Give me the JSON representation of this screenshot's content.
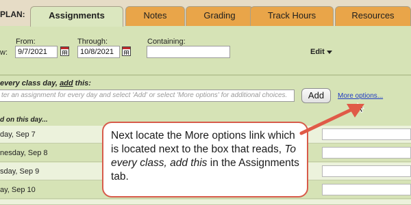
{
  "header": {
    "plan_label": "PLAN:",
    "tabs": [
      {
        "label": "Assignments",
        "active": true
      },
      {
        "label": "Notes",
        "active": false
      },
      {
        "label": "Grading",
        "active": false
      },
      {
        "label": "Track Hours",
        "active": false
      },
      {
        "label": "Resources",
        "active": false
      }
    ]
  },
  "filters": {
    "view_label_fragment": "w:",
    "from_label": "From:",
    "from_value": "9/7/2021",
    "through_label": "Through:",
    "through_value": "10/8/2021",
    "containing_label": "Containing:",
    "containing_value": "",
    "edit_label": "Edit"
  },
  "assign_every_day": {
    "title_prefix": "every class day, ",
    "title_emph": "add",
    "title_suffix": " this:",
    "input_placeholder": "ter an assignment for every day and select 'Add' or select 'More options' for additional choices.",
    "add_button": "Add",
    "more_options_link": "More options..."
  },
  "day_list": {
    "header": "d on this day...",
    "days": [
      {
        "label": "day, Sep 7"
      },
      {
        "label": "nesday, Sep 8"
      },
      {
        "label": "sday, Sep 9"
      },
      {
        "label": "ay, Sep 10"
      }
    ]
  },
  "callout": {
    "text_before": "Next locate the More options link which is located next to the box that reads, ",
    "text_emph": "To every class, add this",
    "text_after": " in the Assignments tab."
  },
  "colors": {
    "background": "#d6e3b6",
    "tab_inactive": "#e9a549",
    "tab_active": "#dbe7bf",
    "link": "#1d39c4",
    "callout_border": "#d75a4a",
    "arrow": "#e05a47"
  }
}
